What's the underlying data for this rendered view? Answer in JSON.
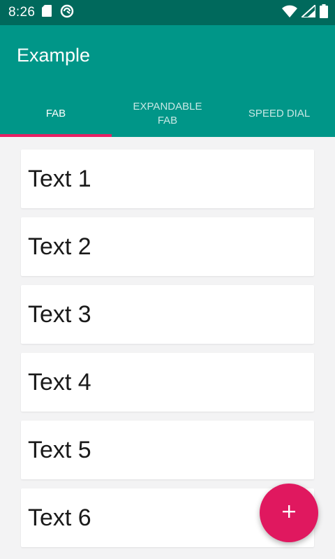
{
  "status_bar": {
    "time": "8:26",
    "left_icons": [
      "sd-card-icon",
      "sync-circle-icon"
    ],
    "right_icons": [
      "wifi-icon",
      "signal-icon",
      "battery-icon"
    ]
  },
  "app_bar": {
    "title": "Example",
    "tabs": [
      {
        "label": "FAB",
        "active": true
      },
      {
        "label": "EXPANDABLE\nFAB",
        "active": false
      },
      {
        "label": "SPEED DIAL",
        "active": false
      }
    ]
  },
  "list": {
    "items": [
      {
        "label": "Text 1"
      },
      {
        "label": "Text 2"
      },
      {
        "label": "Text 3"
      },
      {
        "label": "Text 4"
      },
      {
        "label": "Text 5"
      },
      {
        "label": "Text 6"
      }
    ]
  },
  "fab": {
    "icon": "plus-icon"
  },
  "colors": {
    "status_bar": "#00695c",
    "app_bar": "#009688",
    "accent": "#e0185f",
    "background": "#f3f3f4"
  }
}
